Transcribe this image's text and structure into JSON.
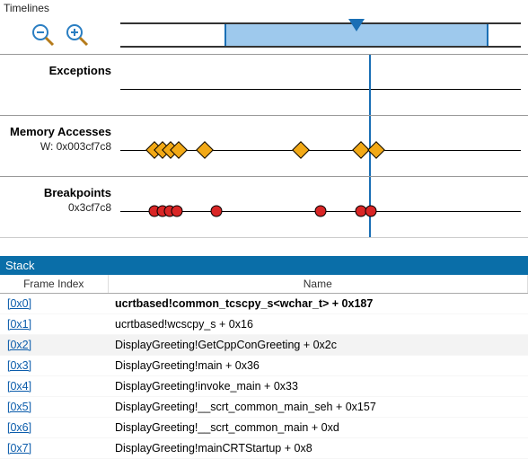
{
  "timelines": {
    "title": "Timelines",
    "zoom_out": "zoom-out",
    "zoom_in": "zoom-in",
    "overview": {
      "range_start_pct": 26,
      "range_end_pct": 92,
      "playhead_pct": 59
    },
    "cursor_pct": 62,
    "tracks": [
      {
        "title": "Exceptions",
        "subtitle": "",
        "marker_shape": "diamond",
        "marker_color": "orange",
        "positions_pct": []
      },
      {
        "title": "Memory Accesses",
        "subtitle": "W: 0x003cf7c8",
        "marker_shape": "diamond",
        "marker_color": "orange",
        "positions_pct": [
          8.5,
          10.5,
          12.5,
          14.5,
          21,
          45,
          60,
          64
        ]
      },
      {
        "title": "Breakpoints",
        "subtitle": "0x3cf7c8",
        "marker_shape": "dot",
        "marker_color": "red",
        "positions_pct": [
          8.5,
          10.5,
          12.3,
          14.1,
          24,
          50,
          60,
          62.5
        ]
      }
    ]
  },
  "stack": {
    "title": "Stack",
    "columns": {
      "frame": "Frame Index",
      "name": "Name"
    },
    "rows": [
      {
        "idx": "[0x0]",
        "name": "ucrtbased!common_tcscpy_s<wchar_t> + 0x187",
        "bold": true
      },
      {
        "idx": "[0x1]",
        "name": "ucrtbased!wcscpy_s + 0x16"
      },
      {
        "idx": "[0x2]",
        "name": "DisplayGreeting!GetCppConGreeting + 0x2c",
        "selected": true
      },
      {
        "idx": "[0x3]",
        "name": "DisplayGreeting!main + 0x36"
      },
      {
        "idx": "[0x4]",
        "name": "DisplayGreeting!invoke_main + 0x33"
      },
      {
        "idx": "[0x5]",
        "name": "DisplayGreeting!__scrt_common_main_seh + 0x157"
      },
      {
        "idx": "[0x6]",
        "name": "DisplayGreeting!__scrt_common_main + 0xd"
      },
      {
        "idx": "[0x7]",
        "name": "DisplayGreeting!mainCRTStartup + 0x8"
      }
    ]
  }
}
